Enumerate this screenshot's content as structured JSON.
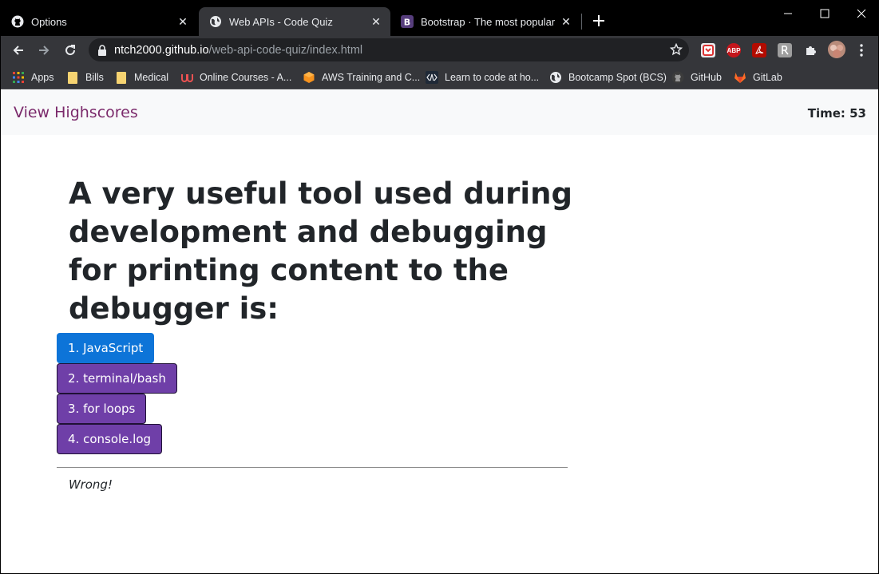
{
  "browser": {
    "tabs": [
      {
        "title": "Options",
        "icon": "github-icon",
        "active": false
      },
      {
        "title": "Web APIs - Code Quiz",
        "icon": "globe-icon",
        "active": true
      },
      {
        "title": "Bootstrap · The most popular HTML",
        "icon": "bootstrap-icon",
        "active": false
      }
    ],
    "url": {
      "host": "ntch2000.github.io",
      "path": "/web-api-code-quiz/index.html"
    },
    "bookmarks": [
      {
        "label": "Apps",
        "icon": "apps-grid-icon"
      },
      {
        "label": "Bills",
        "icon": "folder-icon"
      },
      {
        "label": "Medical",
        "icon": "folder-icon"
      },
      {
        "label": "Online Courses - A...",
        "icon": "udemy-icon"
      },
      {
        "label": "AWS Training and C...",
        "icon": "aws-icon"
      },
      {
        "label": "Learn to code at ho...",
        "icon": "codecademy-icon"
      },
      {
        "label": "Bootcamp Spot (BCS)",
        "icon": "globe-icon"
      },
      {
        "label": "GitHub",
        "icon": "github-icon"
      },
      {
        "label": "GitLab",
        "icon": "gitlab-icon"
      }
    ],
    "extensions": {
      "abp_label": "ABP"
    }
  },
  "page": {
    "highscores_link": "View Highscores",
    "timer": "Time: 53",
    "question": "A very useful tool used during development and debugging for printing content to the debugger is:",
    "answers": [
      {
        "label": "1. JavaScript",
        "state": "selected"
      },
      {
        "label": "2. terminal/bash",
        "state": "default"
      },
      {
        "label": "3. for loops",
        "state": "default"
      },
      {
        "label": "4. console.log",
        "state": "default"
      }
    ],
    "feedback": "Wrong!"
  },
  "colors": {
    "link": "#7b2a6b",
    "answer_selected": "#0d74d8",
    "answer_default": "#6f3fa8",
    "navbar_bg": "#f8f9fa",
    "text": "#212529"
  }
}
